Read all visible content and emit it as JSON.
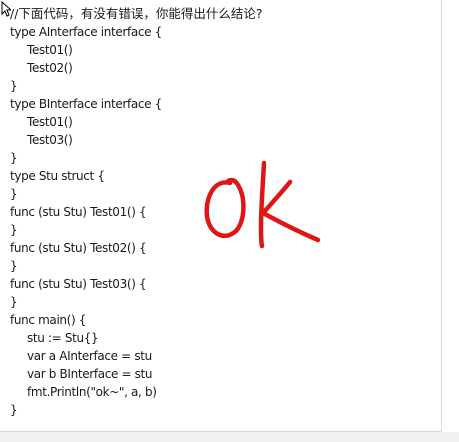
{
  "snippet": {
    "comment": "//下面代码，有没有错误，你能得出什么结论?",
    "lines": [
      "type AInterface interface {",
      "Test01()",
      "Test02()",
      "}",
      "type BInterface interface {",
      "Test01()",
      "Test03()",
      "}",
      "type Stu struct {",
      "}",
      "func (stu Stu) Test01() {",
      "}",
      "func (stu Stu) Test02() {",
      "}",
      "func (stu Stu) Test03() {",
      "}",
      "func main() {",
      "stu := Stu{}",
      "var a AInterface = stu",
      "var b BInterface = stu",
      "fmt.Println(\"ok~\", a, b)",
      "}"
    ]
  },
  "annotation": {
    "text": "ok",
    "ink_color": "#e01515"
  },
  "icons": {
    "cursor": "mouse-pointer-icon"
  }
}
